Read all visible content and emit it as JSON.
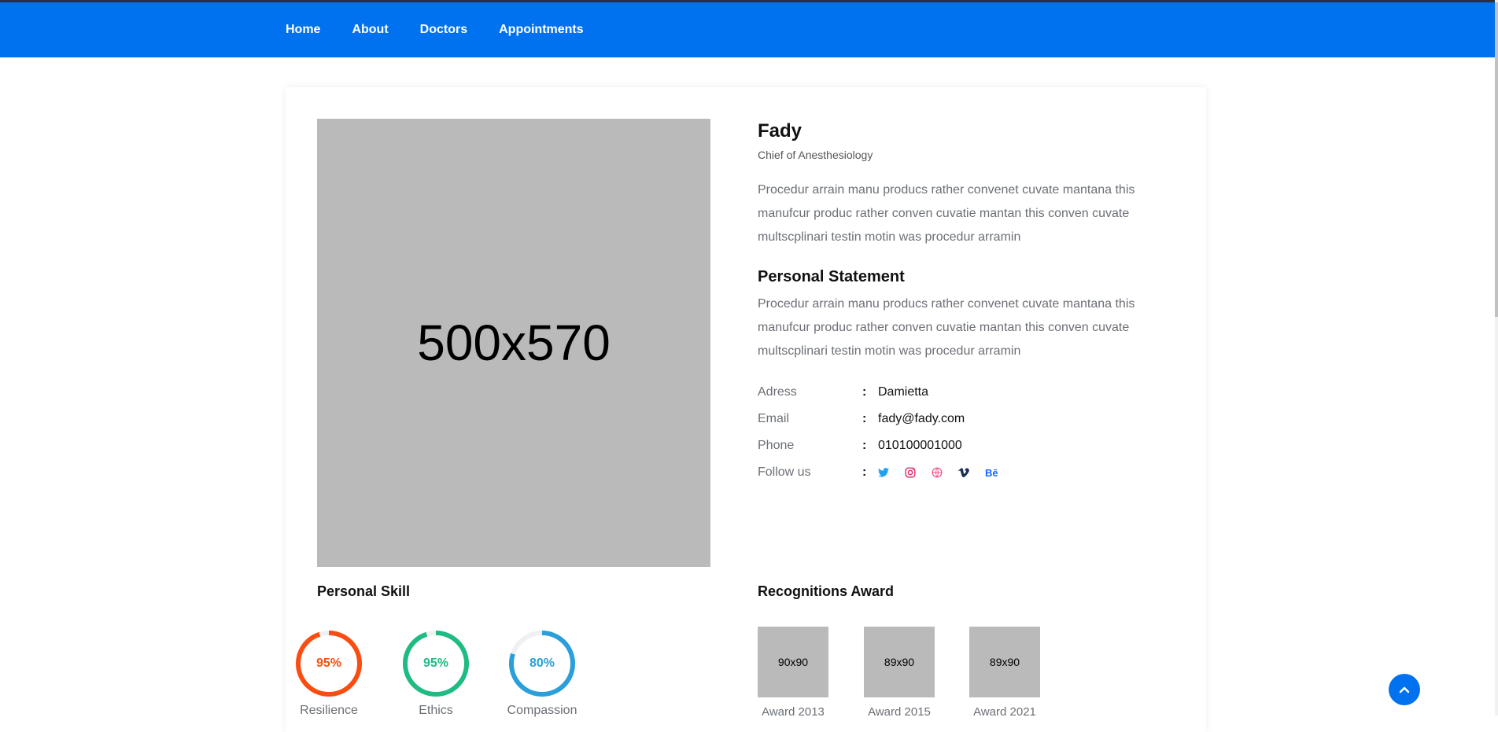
{
  "nav": {
    "items": [
      {
        "label": "Home"
      },
      {
        "label": "About"
      },
      {
        "label": "Doctors"
      },
      {
        "label": "Appointments"
      }
    ],
    "bg_color": "#0072ef"
  },
  "doctor": {
    "photo_placeholder": "500x570",
    "name": "Fady",
    "title": "Chief of Anesthesiology",
    "bio": "Procedur arrain manu producs rather convenet cuvate mantana this manufcur produc rather conven cuvatie mantan this conven cuvate multscplinari testin motin was procedur arramin",
    "statement_heading": "Personal Statement",
    "statement": "Procedur arrain manu producs rather convenet cuvate mantana this manufcur produc rather conven cuvatie mantan this conven cuvate multscplinari testin motin was procedur arramin",
    "details": [
      {
        "label": "Adress",
        "sep": ":",
        "value": "Damietta"
      },
      {
        "label": "Email",
        "sep": ":",
        "value": "fady@fady.com"
      },
      {
        "label": "Phone",
        "sep": ":",
        "value": "010100001000"
      }
    ],
    "follow_label": "Follow us",
    "follow_sep": ":",
    "socials": [
      {
        "icon": "twitter-icon",
        "color": "#1da1f2"
      },
      {
        "icon": "instagram-icon",
        "color": "#e1306c"
      },
      {
        "icon": "dribbble-icon",
        "color": "#ea4c89"
      },
      {
        "icon": "vimeo-icon",
        "color": "#1a2e5a"
      },
      {
        "icon": "behance-icon",
        "glyph": "Bē",
        "color": "#1769ff"
      }
    ]
  },
  "skills": {
    "heading": "Personal Skill",
    "items": [
      {
        "label": "Resilience",
        "percent": 95,
        "percent_text": "95%",
        "color": "#fb4d12"
      },
      {
        "label": "Ethics",
        "percent": 95,
        "percent_text": "95%",
        "color": "#1ebc82"
      },
      {
        "label": "Compassion",
        "percent": 80,
        "percent_text": "80%",
        "color": "#2a9fd9"
      }
    ]
  },
  "awards": {
    "heading": "Recognitions Award",
    "items": [
      {
        "placeholder": "90x90",
        "label": "Award 2013"
      },
      {
        "placeholder": "89x90",
        "label": "Award 2015"
      },
      {
        "placeholder": "89x90",
        "label": "Award 2021"
      }
    ]
  }
}
